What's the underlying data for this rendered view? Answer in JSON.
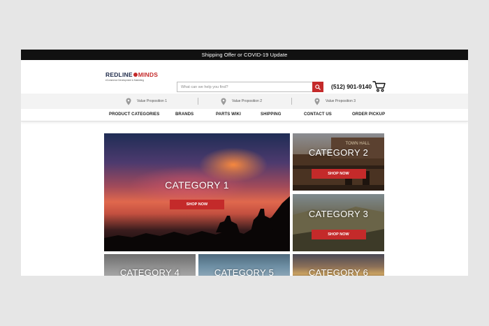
{
  "topbar": {
    "text": "Shipping Offer or COVID-19 Update"
  },
  "logo": {
    "brand_left": "REDLINE",
    "brand_right": "MINDS",
    "tagline": "eCommerce Development & Marketing"
  },
  "search": {
    "placeholder": "What can we help you find?"
  },
  "header": {
    "phone": "(512) 901-9140"
  },
  "value_props": [
    {
      "label": "Value Proposition 1"
    },
    {
      "label": "Value Proposition 2"
    },
    {
      "label": "Value Proposition 3"
    }
  ],
  "nav": {
    "items": [
      {
        "label": "PRODUCT CATEGORIES"
      },
      {
        "label": "BRANDS"
      },
      {
        "label": "PARTS WIKI"
      },
      {
        "label": "SHIPPING"
      },
      {
        "label": "CONTACT US"
      },
      {
        "label": "ORDER PICKUP"
      }
    ]
  },
  "categories": [
    {
      "title": "CATEGORY 1",
      "button": "SHOP NOW"
    },
    {
      "title": "CATEGORY 2",
      "button": "SHOP NOW",
      "sign": "TOWN HALL"
    },
    {
      "title": "CATEGORY 3",
      "button": "SHOP NOW"
    },
    {
      "title": "CATEGORY 4"
    },
    {
      "title": "CATEGORY 5"
    },
    {
      "title": "CATEGORY 6"
    }
  ],
  "colors": {
    "accent": "#c42a2a",
    "topbar": "#111111",
    "navy": "#1f2b4a"
  },
  "icons": [
    "search-icon",
    "cart-icon",
    "location-pin-icon"
  ]
}
